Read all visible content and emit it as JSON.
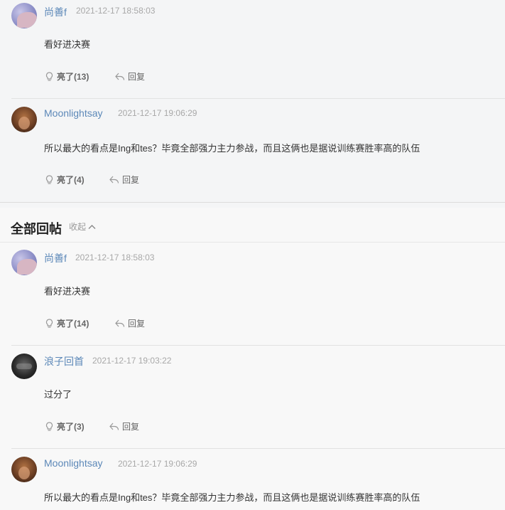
{
  "top_posts": [
    {
      "username": "尚善f",
      "time": "2021-12-17 18:58:03",
      "content": "看好进决赛",
      "like_label": "亮了(13)",
      "reply_label": "回复",
      "avatar": "purple-avatar"
    },
    {
      "username": "Moonlightsay",
      "time": "2021-12-17 19:06:29",
      "content": "所以最大的看点是Ing和tes？毕竟全部强力主力参战，而且这俩也是据说训练赛胜率高的队伍",
      "like_label": "亮了(4)",
      "reply_label": "回复",
      "avatar": "brown-avatar"
    }
  ],
  "section": {
    "title": "全部回帖",
    "collapse_label": "收起",
    "collapse_icon": "chevron-up-icon"
  },
  "all_posts": [
    {
      "username": "尚善f",
      "time": "2021-12-17 18:58:03",
      "content": "看好进决赛",
      "like_label": "亮了(14)",
      "reply_label": "回复",
      "avatar": "purple-avatar"
    },
    {
      "username": "浪子回首",
      "time": "2021-12-17 19:03:22",
      "content": "过分了",
      "like_label": "亮了(3)",
      "reply_label": "回复",
      "avatar": "dark-avatar"
    },
    {
      "username": "Moonlightsay",
      "time": "2021-12-17 19:06:29",
      "content": "所以最大的看点是Ing和tes？毕竟全部强力主力参战，而且这俩也是据说训练赛胜率高的队伍",
      "avatar": "brown-avatar"
    }
  ],
  "icons": {
    "like": "lightbulb-icon",
    "reply": "reply-arrow-icon"
  },
  "colors": {
    "username": "#5c88b8",
    "timestamp": "#a8a8a8",
    "top_bg": "#f4f5f6",
    "bottom_bg": "#f8f8f8"
  }
}
